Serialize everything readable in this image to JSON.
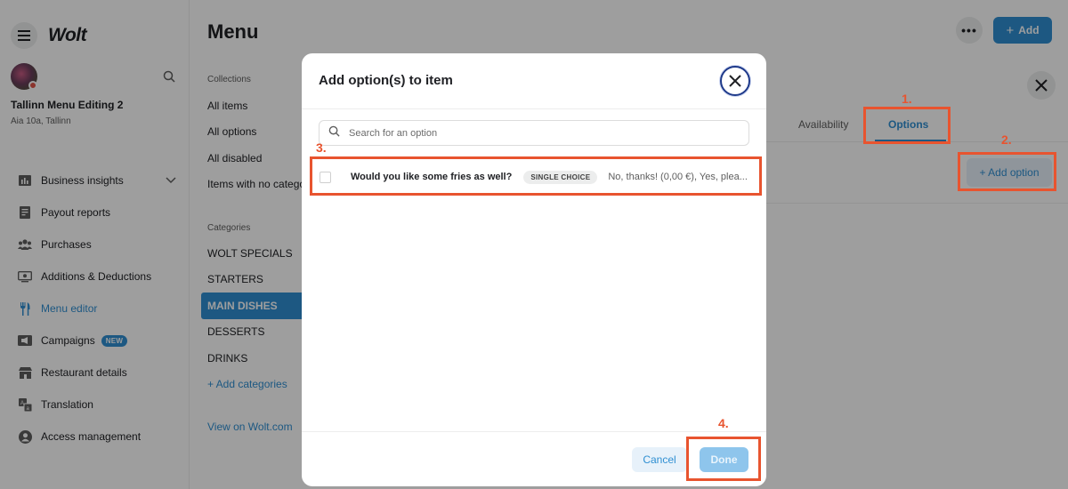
{
  "app": {
    "logo": "Wolt"
  },
  "venue": {
    "name": "Tallinn Menu Editing 2",
    "address": "Aia 10a, Tallinn"
  },
  "sidebar": {
    "items": [
      {
        "label": "Business insights",
        "icon": "bar-chart-icon",
        "has_chevron": true
      },
      {
        "label": "Payout reports",
        "icon": "document-icon"
      },
      {
        "label": "Purchases",
        "icon": "people-icon"
      },
      {
        "label": "Additions & Deductions",
        "icon": "money-icon"
      },
      {
        "label": "Menu editor",
        "icon": "fork-knife-icon",
        "active": true
      },
      {
        "label": "Campaigns",
        "icon": "megaphone-icon",
        "badge": "NEW"
      },
      {
        "label": "Restaurant details",
        "icon": "store-icon"
      },
      {
        "label": "Translation",
        "icon": "translate-icon"
      },
      {
        "label": "Access management",
        "icon": "user-icon"
      }
    ]
  },
  "header": {
    "title": "Menu",
    "add_label": "Add",
    "more_label": "•••"
  },
  "collections": {
    "heading": "Collections",
    "items": [
      "All items",
      "All options",
      "All disabled",
      "Items with no catego"
    ]
  },
  "categories": {
    "heading": "Categories",
    "items": [
      "WOLT SPECIALS",
      "STARTERS",
      "MAIN DISHES",
      "DESSERTS",
      "DRINKS"
    ],
    "active": "MAIN DISHES",
    "add_label": "+ Add categories"
  },
  "view_on": "View on Wolt.com",
  "item_panel": {
    "tabs": [
      "Availability",
      "Options"
    ],
    "active_tab": "Options",
    "add_option_label": "+ Add option"
  },
  "modal": {
    "title": "Add option(s) to item",
    "search_placeholder": "Search for an option",
    "options": [
      {
        "name": "Would you like some fries as well?",
        "type": "SINGLE CHOICE",
        "values": "No, thanks! (0,00 €), Yes, plea...",
        "checked": false
      }
    ],
    "cancel_label": "Cancel",
    "done_label": "Done"
  },
  "annotations": [
    "1.",
    "2.",
    "3.",
    "4."
  ],
  "colors": {
    "accent": "#2f8fd2",
    "annotation": "#e8542f"
  }
}
